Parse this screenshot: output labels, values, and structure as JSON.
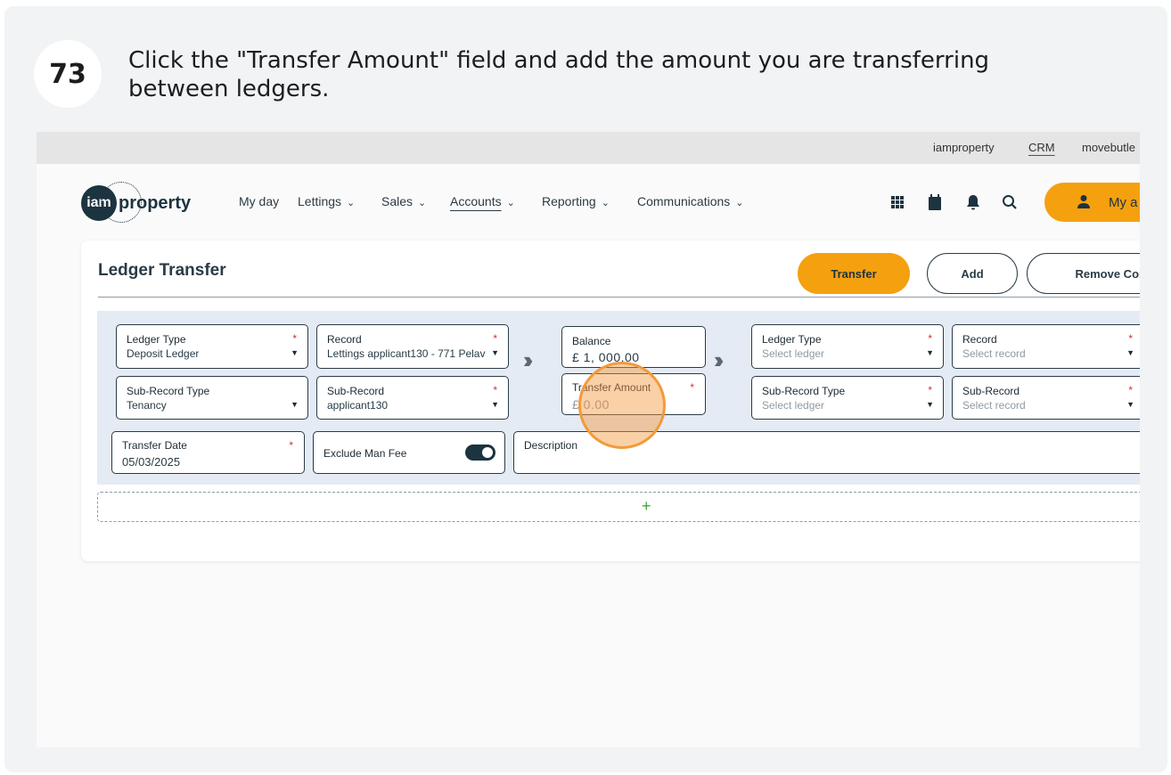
{
  "guide": {
    "step_number": "73",
    "instruction": "Click the \"Transfer Amount\" field and add the amount you are transferring between ledgers."
  },
  "topbar": {
    "links": [
      "iamproperty",
      "CRM",
      "movebutle"
    ]
  },
  "navbar": {
    "logo": {
      "mark": "iam",
      "text": "property"
    },
    "items": [
      {
        "label": "My day"
      },
      {
        "label": "Lettings"
      },
      {
        "label": "Sales"
      },
      {
        "label": "Accounts"
      },
      {
        "label": "Reporting"
      },
      {
        "label": "Communications"
      }
    ],
    "active_item": "Accounts",
    "icons": [
      "apps-grid-icon",
      "calendar-icon",
      "bell-icon",
      "search-icon"
    ],
    "account_button": "My a"
  },
  "panel": {
    "title": "Ledger Transfer",
    "buttons": {
      "transfer": "Transfer",
      "add": "Add",
      "remove": "Remove Comp"
    }
  },
  "from": {
    "ledger_type": {
      "label": "Ledger Type",
      "value": "Deposit Ledger"
    },
    "record": {
      "label": "Record",
      "value": "Lettings applicant130 - 771 Pelav"
    },
    "sub_record_type": {
      "label": "Sub-Record Type",
      "value": "Tenancy"
    },
    "sub_record": {
      "label": "Sub-Record",
      "value": "applicant130"
    }
  },
  "balance": {
    "label": "Balance",
    "value": "£ 1, 000.00"
  },
  "transfer_amount": {
    "label": "Transfer Amount",
    "value": "£ 0.00"
  },
  "to": {
    "ledger_type": {
      "label": "Ledger Type",
      "placeholder": "Select ledger"
    },
    "record": {
      "label": "Record",
      "placeholder": "Select record"
    },
    "sub_record_type": {
      "label": "Sub-Record Type",
      "placeholder": "Select ledger"
    },
    "sub_record": {
      "label": "Sub-Record",
      "placeholder": "Select record"
    }
  },
  "transfer_date": {
    "label": "Transfer Date",
    "value": "05/03/2025"
  },
  "exclude_man_fee": {
    "label": "Exclude Man Fee",
    "enabled": true
  },
  "description": {
    "label": "Description",
    "value": ""
  },
  "required_mark": "*",
  "add_row_symbol": "+",
  "colors": {
    "accent": "#f5a00f",
    "navy": "#1c3340",
    "form_bg": "#e4ebf5",
    "required": "#d62e2e",
    "click_highlight": "#f29a3a"
  }
}
